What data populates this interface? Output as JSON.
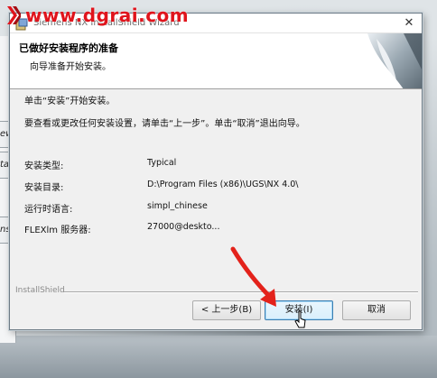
{
  "watermark": {
    "text": "www.dgrai.com"
  },
  "window": {
    "title": "Siemens NX InstallShield Wizard",
    "close_glyph": "✕"
  },
  "header": {
    "title": "已做好安装程序的准备",
    "subtitle": "向导准备开始安装。"
  },
  "body": {
    "line1": "单击“安装”开始安装。",
    "line2": "要查看或更改任何安装设置，请单击“上一步”。单击“取消”退出向导。"
  },
  "info": [
    {
      "label": "安装类型:",
      "value": "Typical"
    },
    {
      "label": "安装目录:",
      "value": "D:\\Program Files (x86)\\UGS\\NX 4.0\\"
    },
    {
      "label": "运行时语言:",
      "value": "simpl_chinese"
    },
    {
      "label": "FLEXlm 服务器:",
      "value": "27000@deskto..."
    }
  ],
  "footer": {
    "brand": "InstallShield"
  },
  "buttons": {
    "back": "< 上一步(B)",
    "install": "安装(I)",
    "cancel": "取消"
  },
  "background": {
    "left_buttons": [
      "ew",
      "tall",
      "nst"
    ]
  },
  "colors": {
    "arrow": "#e3221b",
    "watermark": "#e0141c",
    "default_border": "#3c7fb1"
  }
}
